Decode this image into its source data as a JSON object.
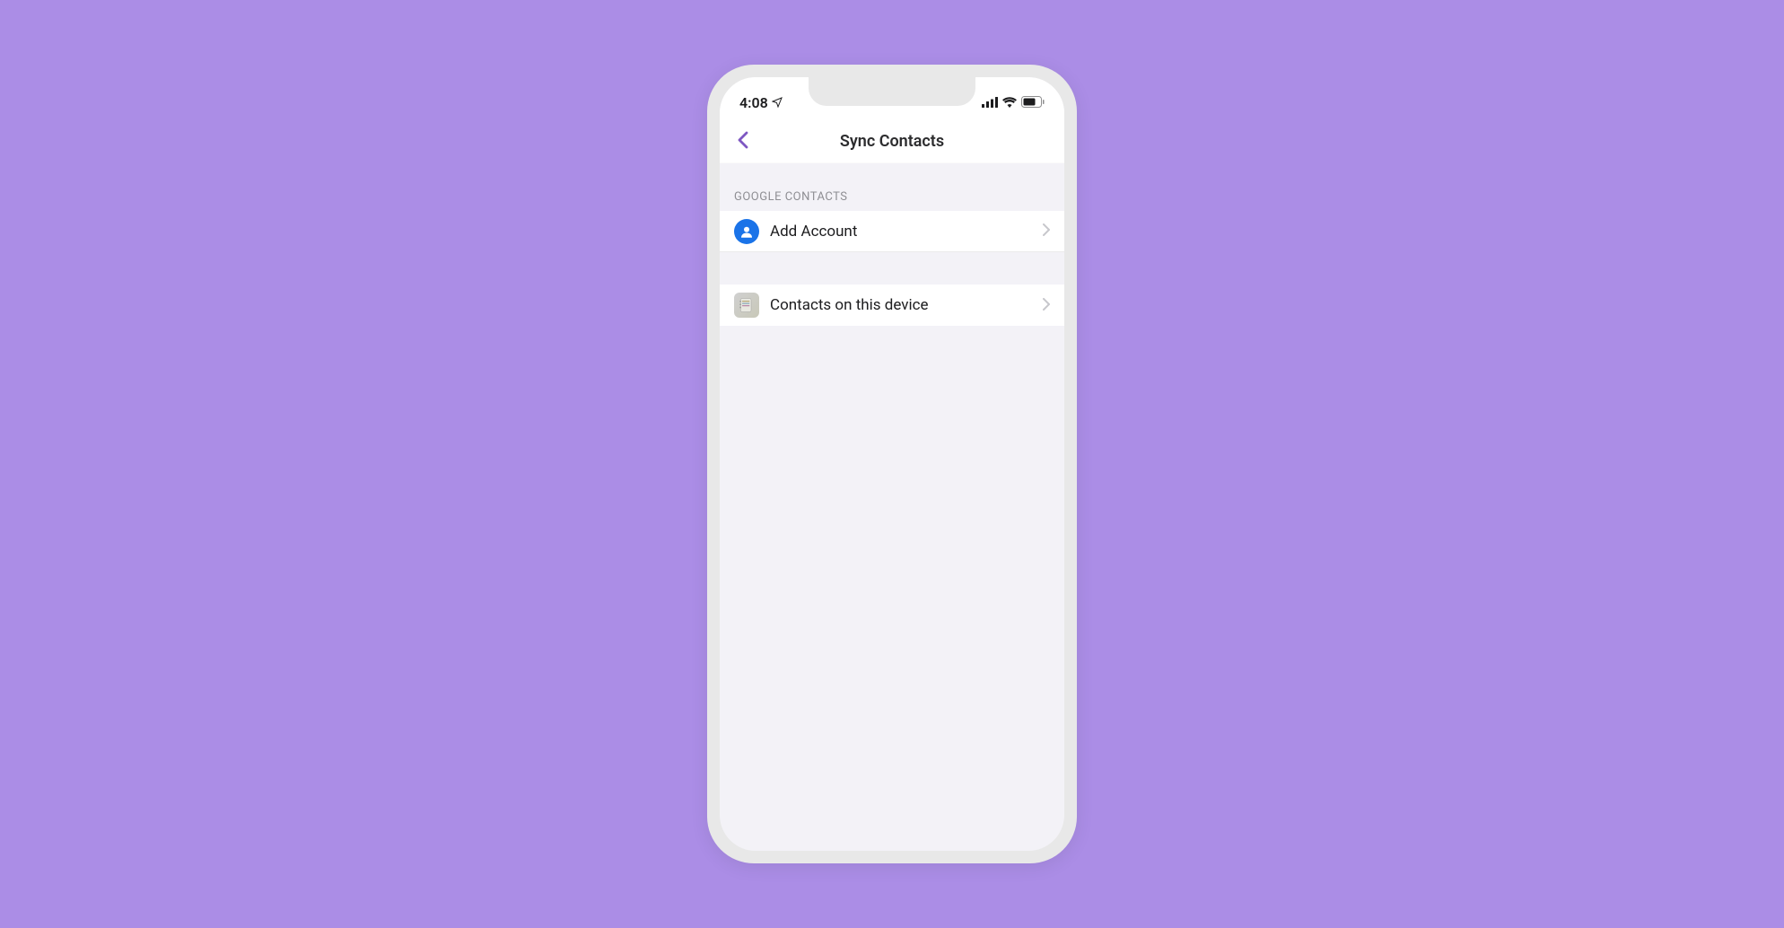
{
  "status_bar": {
    "time": "4:08"
  },
  "nav": {
    "title": "Sync Contacts"
  },
  "sections": {
    "google": {
      "header": "GOOGLE CONTACTS",
      "items": [
        {
          "label": "Add Account"
        }
      ]
    },
    "device": {
      "items": [
        {
          "label": "Contacts on this device"
        }
      ]
    }
  },
  "colors": {
    "background": "#ab8de6",
    "accent": "#7e57c2",
    "google_blue": "#1a73e8"
  }
}
